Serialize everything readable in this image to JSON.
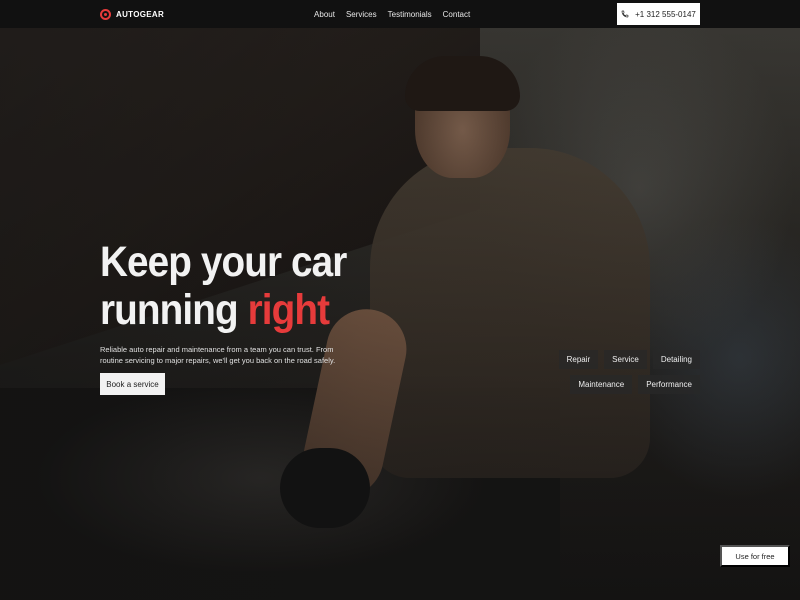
{
  "brand": {
    "name": "AUTOGEAR",
    "accent": "#e63b3b"
  },
  "nav": {
    "links": [
      "About",
      "Services",
      "Testimonials",
      "Contact"
    ],
    "phone": "+1 312 555-0147"
  },
  "hero": {
    "title_part1": "Keep your car",
    "title_part2": "running",
    "title_accent": "right",
    "description": "Reliable auto repair and maintenance from a team you can trust. From routine servicing to major repairs, we'll get you back on the road safely.",
    "cta_label": "Book a service"
  },
  "tags": [
    "Repair",
    "Service",
    "Detailing",
    "Maintenance",
    "Performance"
  ],
  "footer": {
    "use_free_label": "Use for free"
  }
}
